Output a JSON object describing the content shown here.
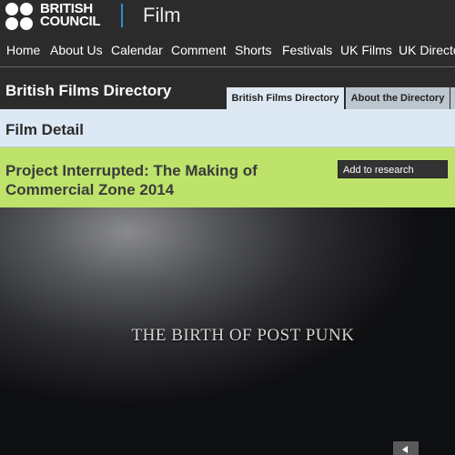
{
  "header": {
    "org_line1": "BRITISH",
    "org_line2": "COUNCIL",
    "section": "Film"
  },
  "nav": {
    "items": [
      "Home",
      "About Us",
      "Calendar",
      "Comment",
      "Shorts",
      "Festivals",
      "UK Films",
      "UK Directo"
    ]
  },
  "directory": {
    "title": "British Films Directory",
    "tabs": [
      {
        "label": "British Films Directory",
        "active": true
      },
      {
        "label": "About the Directory",
        "active": false
      }
    ]
  },
  "detail": {
    "heading": "Film Detail"
  },
  "film": {
    "title_line1": "Project Interrupted: The Making of",
    "title_line2": "Commercial Zone 2014",
    "research_button": "Add to research"
  },
  "video": {
    "caption": "THE BIRTH OF POST PUNK"
  },
  "colors": {
    "accent_blue": "#2a8fd1",
    "film_bar": "#bde36b",
    "detail_bar": "#dde8f5",
    "dark": "#2b2b2b"
  },
  "icons": [
    "british-council-logo",
    "chevron-left-icon"
  ]
}
